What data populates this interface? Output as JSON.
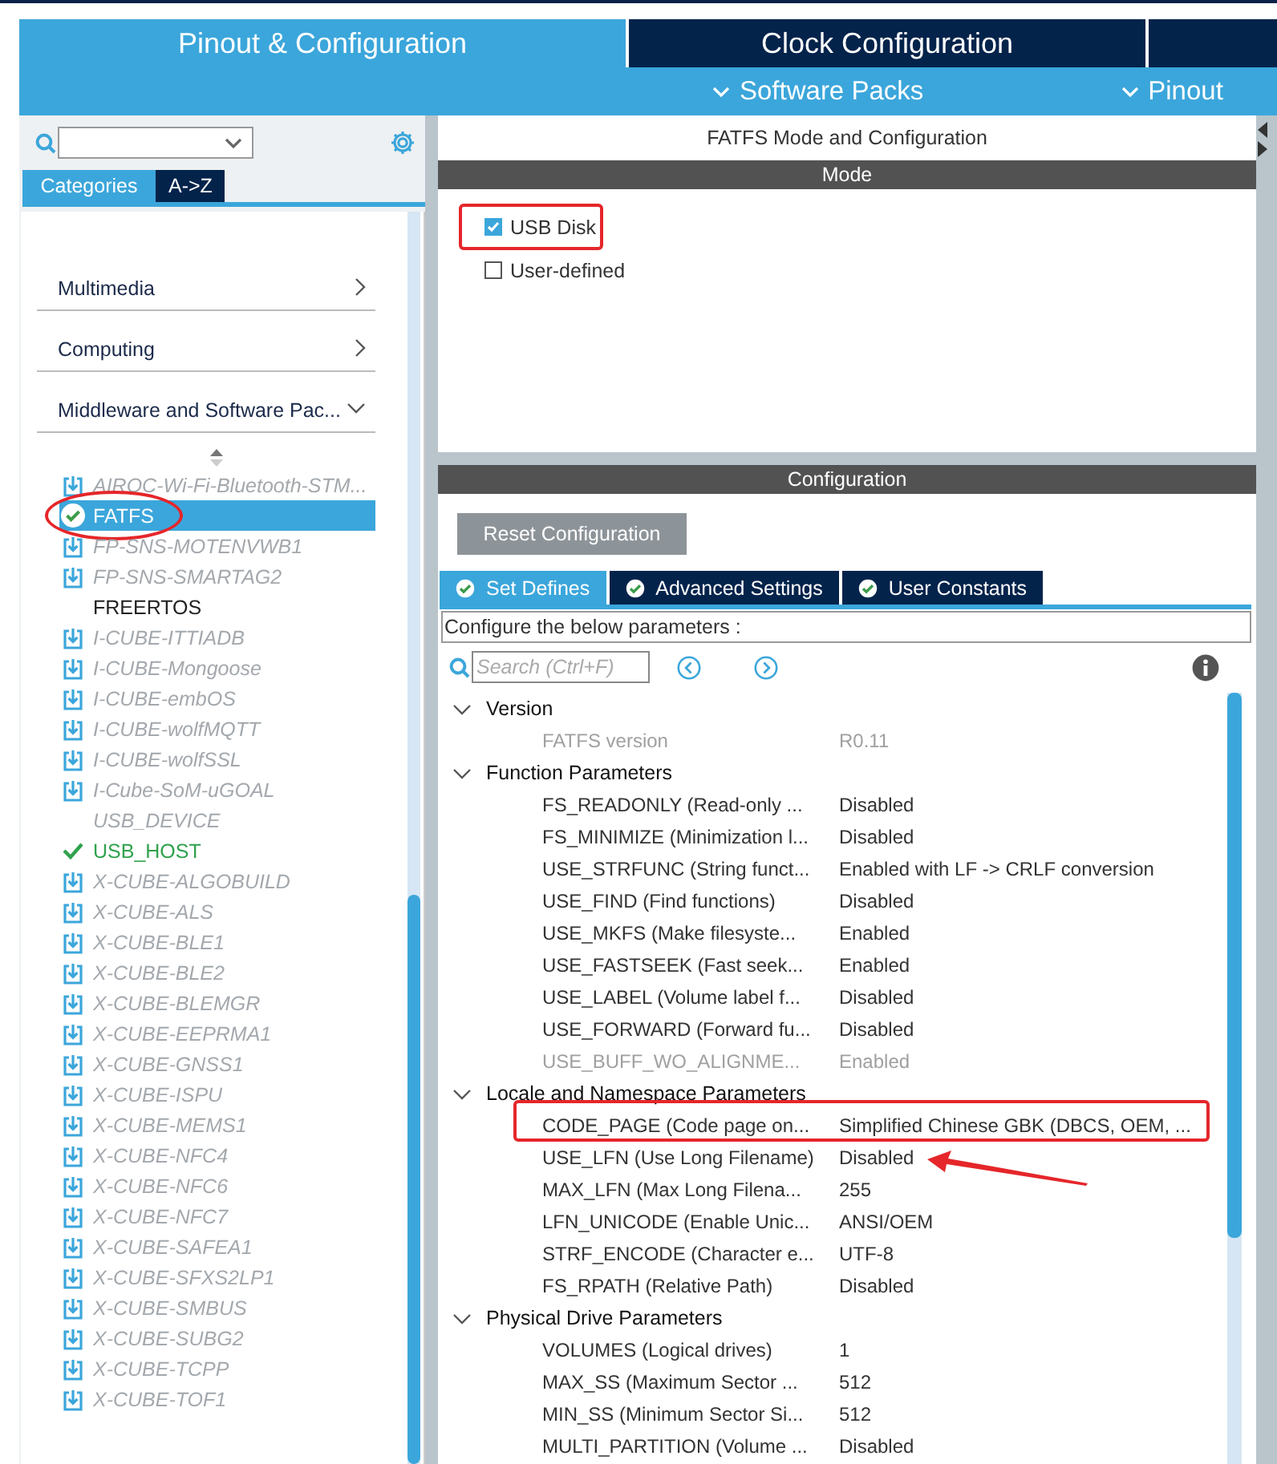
{
  "top_tabs": [
    {
      "label": "Pinout & Configuration",
      "selected": true
    },
    {
      "label": "Clock Configuration",
      "selected": false
    }
  ],
  "menus": [
    {
      "label": "Software Packs"
    },
    {
      "label": "Pinout"
    }
  ],
  "sidebar": {
    "view_tabs": [
      {
        "label": "Categories",
        "selected": true
      },
      {
        "label": "A->Z",
        "selected": false
      }
    ],
    "categories": [
      {
        "label": "Multimedia",
        "expanded": false
      },
      {
        "label": "Computing",
        "expanded": false
      },
      {
        "label": "Middleware and Software Pac...",
        "expanded": true
      }
    ],
    "items": [
      {
        "label": "AIROC-Wi-Fi-Bluetooth-STM...",
        "kind": "download",
        "selected": false,
        "circled": false
      },
      {
        "label": "FATFS",
        "kind": "check-circle",
        "selected": true,
        "circled": true
      },
      {
        "label": "FP-SNS-MOTENVWB1",
        "kind": "download",
        "selected": false,
        "circled": false
      },
      {
        "label": "FP-SNS-SMARTAG2",
        "kind": "download",
        "selected": false,
        "circled": false
      },
      {
        "label": "FREERTOS",
        "kind": "plain",
        "selected": false,
        "circled": false
      },
      {
        "label": "I-CUBE-ITTIADB",
        "kind": "download",
        "selected": false,
        "circled": false
      },
      {
        "label": "I-CUBE-Mongoose",
        "kind": "download",
        "selected": false,
        "circled": false
      },
      {
        "label": "I-CUBE-embOS",
        "kind": "download",
        "selected": false,
        "circled": false
      },
      {
        "label": "I-CUBE-wolfMQTT",
        "kind": "download",
        "selected": false,
        "circled": false
      },
      {
        "label": "I-CUBE-wolfSSL",
        "kind": "download",
        "selected": false,
        "circled": false
      },
      {
        "label": "I-Cube-SoM-uGOAL",
        "kind": "download",
        "selected": false,
        "circled": false
      },
      {
        "label": "USB_DEVICE",
        "kind": "unavailable",
        "selected": false,
        "circled": false
      },
      {
        "label": "USB_HOST",
        "kind": "check",
        "selected": false,
        "circled": false
      },
      {
        "label": "X-CUBE-ALGOBUILD",
        "kind": "download",
        "selected": false,
        "circled": false
      },
      {
        "label": "X-CUBE-ALS",
        "kind": "download",
        "selected": false,
        "circled": false
      },
      {
        "label": "X-CUBE-BLE1",
        "kind": "download",
        "selected": false,
        "circled": false
      },
      {
        "label": "X-CUBE-BLE2",
        "kind": "download",
        "selected": false,
        "circled": false
      },
      {
        "label": "X-CUBE-BLEMGR",
        "kind": "download",
        "selected": false,
        "circled": false
      },
      {
        "label": "X-CUBE-EEPRMA1",
        "kind": "download",
        "selected": false,
        "circled": false
      },
      {
        "label": "X-CUBE-GNSS1",
        "kind": "download",
        "selected": false,
        "circled": false
      },
      {
        "label": "X-CUBE-ISPU",
        "kind": "download",
        "selected": false,
        "circled": false
      },
      {
        "label": "X-CUBE-MEMS1",
        "kind": "download",
        "selected": false,
        "circled": false
      },
      {
        "label": "X-CUBE-NFC4",
        "kind": "download",
        "selected": false,
        "circled": false
      },
      {
        "label": "X-CUBE-NFC6",
        "kind": "download",
        "selected": false,
        "circled": false
      },
      {
        "label": "X-CUBE-NFC7",
        "kind": "download",
        "selected": false,
        "circled": false
      },
      {
        "label": "X-CUBE-SAFEA1",
        "kind": "download",
        "selected": false,
        "circled": false
      },
      {
        "label": "X-CUBE-SFXS2LP1",
        "kind": "download",
        "selected": false,
        "circled": false
      },
      {
        "label": "X-CUBE-SMBUS",
        "kind": "download",
        "selected": false,
        "circled": false
      },
      {
        "label": "X-CUBE-SUBG2",
        "kind": "download",
        "selected": false,
        "circled": false
      },
      {
        "label": "X-CUBE-TCPP",
        "kind": "download",
        "selected": false,
        "circled": false
      },
      {
        "label": "X-CUBE-TOF1",
        "kind": "download",
        "selected": false,
        "circled": false
      }
    ]
  },
  "mode": {
    "title": "FATFS Mode and Configuration",
    "heading": "Mode",
    "options": [
      {
        "label": "USB Disk",
        "checked": true,
        "highlighted": true
      },
      {
        "label": "User-defined",
        "checked": false,
        "highlighted": false
      }
    ]
  },
  "configuration": {
    "heading": "Configuration",
    "reset_button": "Reset Configuration",
    "tabs": [
      {
        "label": "Set Defines",
        "selected": true
      },
      {
        "label": "Advanced Settings",
        "selected": false
      },
      {
        "label": "User Constants",
        "selected": false
      }
    ],
    "description": "Configure the below parameters :",
    "search": {
      "placeholder": "Search (Ctrl+F)"
    },
    "groups": [
      {
        "name": "Version",
        "expanded": true,
        "params": [
          {
            "name": "FATFS version",
            "value": "R0.11",
            "disabled": true,
            "highlighted": false,
            "arrow": false
          }
        ]
      },
      {
        "name": "Function Parameters",
        "expanded": true,
        "params": [
          {
            "name": "FS_READONLY (Read-only ...",
            "value": "Disabled",
            "disabled": false,
            "highlighted": false,
            "arrow": false
          },
          {
            "name": "FS_MINIMIZE (Minimization l...",
            "value": "Disabled",
            "disabled": false,
            "highlighted": false,
            "arrow": false
          },
          {
            "name": "USE_STRFUNC (String funct...",
            "value": "Enabled with LF -> CRLF conversion",
            "disabled": false,
            "highlighted": false,
            "arrow": false
          },
          {
            "name": "USE_FIND (Find functions)",
            "value": "Disabled",
            "disabled": false,
            "highlighted": false,
            "arrow": false
          },
          {
            "name": "USE_MKFS (Make filesyste...",
            "value": "Enabled",
            "disabled": false,
            "highlighted": false,
            "arrow": false
          },
          {
            "name": "USE_FASTSEEK (Fast seek...",
            "value": "Enabled",
            "disabled": false,
            "highlighted": false,
            "arrow": false
          },
          {
            "name": "USE_LABEL (Volume label f...",
            "value": "Disabled",
            "disabled": false,
            "highlighted": false,
            "arrow": false
          },
          {
            "name": "USE_FORWARD (Forward fu...",
            "value": "Disabled",
            "disabled": false,
            "highlighted": false,
            "arrow": false
          },
          {
            "name": "USE_BUFF_WO_ALIGNME...",
            "value": "Enabled",
            "disabled": true,
            "highlighted": false,
            "arrow": false
          }
        ]
      },
      {
        "name": "Locale and Namespace Parameters",
        "expanded": true,
        "params": [
          {
            "name": "CODE_PAGE (Code page on...",
            "value": "Simplified Chinese GBK (DBCS, OEM, ...",
            "disabled": false,
            "highlighted": true,
            "arrow": false
          },
          {
            "name": "USE_LFN (Use Long Filename)",
            "value": "Disabled",
            "disabled": false,
            "highlighted": false,
            "arrow": true
          },
          {
            "name": "MAX_LFN (Max Long Filena...",
            "value": "255",
            "disabled": false,
            "highlighted": false,
            "arrow": false
          },
          {
            "name": "LFN_UNICODE (Enable Unic...",
            "value": "ANSI/OEM",
            "disabled": false,
            "highlighted": false,
            "arrow": false
          },
          {
            "name": "STRF_ENCODE (Character e...",
            "value": "UTF-8",
            "disabled": false,
            "highlighted": false,
            "arrow": false
          },
          {
            "name": "FS_RPATH (Relative Path)",
            "value": "Disabled",
            "disabled": false,
            "highlighted": false,
            "arrow": false
          }
        ]
      },
      {
        "name": "Physical Drive Parameters",
        "expanded": true,
        "params": [
          {
            "name": "VOLUMES (Logical drives)",
            "value": "1",
            "disabled": false,
            "highlighted": false,
            "arrow": false
          },
          {
            "name": "MAX_SS (Maximum Sector ...",
            "value": "512",
            "disabled": false,
            "highlighted": false,
            "arrow": false
          },
          {
            "name": "MIN_SS (Minimum Sector Si...",
            "value": "512",
            "disabled": false,
            "highlighted": false,
            "arrow": false
          },
          {
            "name": "MULTI_PARTITION (Volume ...",
            "value": "Disabled",
            "disabled": false,
            "highlighted": false,
            "arrow": false
          }
        ]
      }
    ]
  }
}
